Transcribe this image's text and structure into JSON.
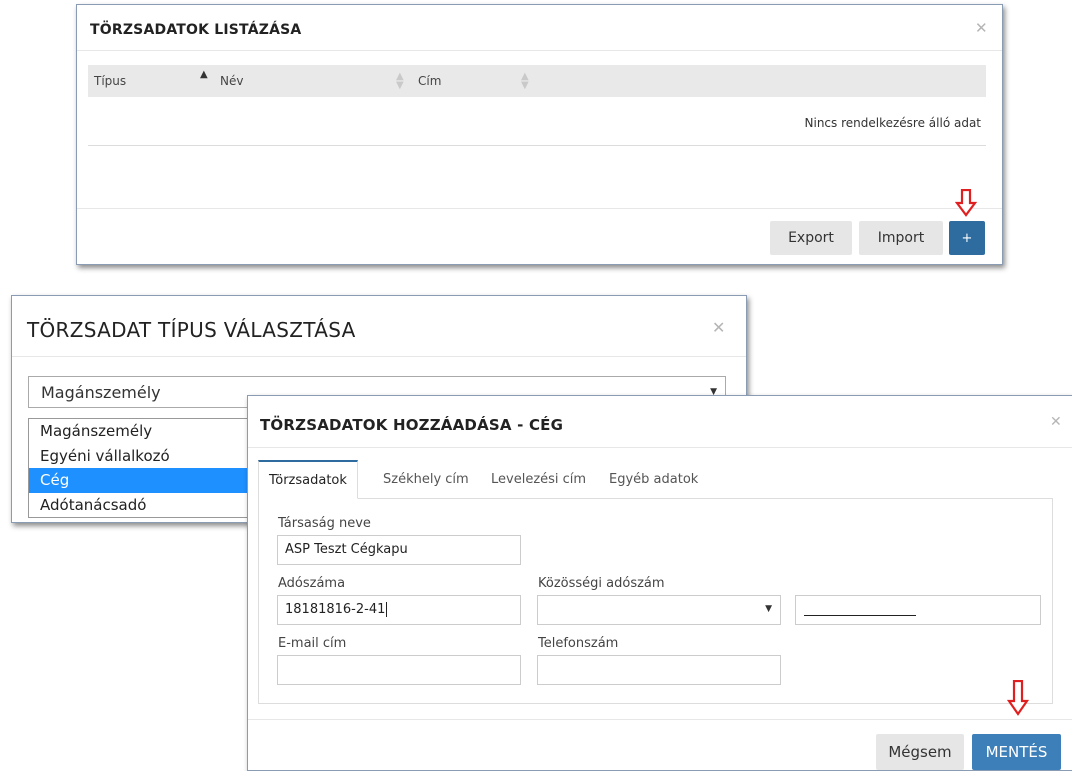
{
  "list_modal": {
    "title": "TÖRZSADATOK LISTÁZÁSA",
    "columns": [
      "Típus",
      "Név",
      "Cím"
    ],
    "empty_text": "Nincs rendelkezésre álló adat",
    "export_label": "Export",
    "import_label": "Import",
    "add_label": "+"
  },
  "type_modal": {
    "title": "TÖRZSADAT TÍPUS VÁLASZTÁSA",
    "selected": "Magánszemély",
    "options": [
      "Magánszemély",
      "Egyéni vállalkozó",
      "Cég",
      "Adótanácsadó"
    ],
    "highlighted": "Cég"
  },
  "add_modal": {
    "title": "TÖRZSADATOK HOZZÁADÁSA - CÉG",
    "tabs": [
      "Törzsadatok",
      "Székhely cím",
      "Levelezési cím",
      "Egyéb adatok"
    ],
    "fields": {
      "company_name_label": "Társaság neve",
      "company_name_value": "ASP Teszt Cégkapu",
      "tax_number_label": "Adószáma",
      "tax_number_value": "18181816-2-41",
      "eu_tax_label": "Közösségi adószám",
      "email_label": "E-mail cím",
      "phone_label": "Telefonszám"
    },
    "cancel_label": "Mégsem",
    "save_label": "MENTÉS"
  },
  "colors": {
    "primary": "#2e6b9e",
    "highlight": "#1e90ff",
    "arrow": "#e02020"
  }
}
